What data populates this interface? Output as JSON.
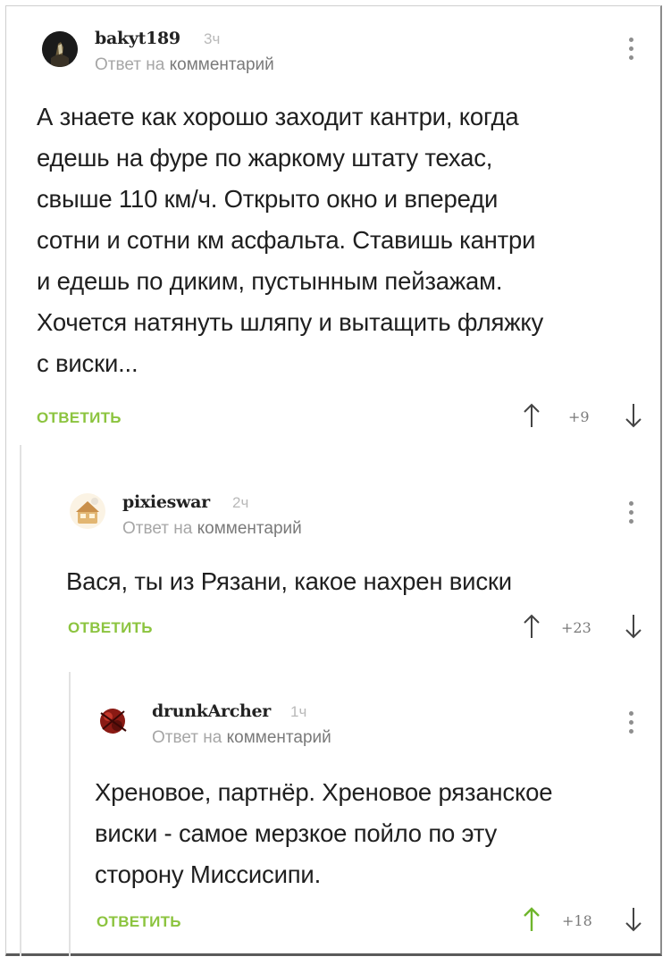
{
  "comments": [
    {
      "username": "bakyt189",
      "time": "3ч",
      "reply_prefix": "Ответ на",
      "reply_link": "комментарий",
      "body": [
        "А знаете как хорошо заходит кантри, когда",
        "едешь на фуре по жаркому штату техас,",
        "свыше 110 км/ч. Открыто окно и впереди",
        "сотни и сотни км асфальта. Ставишь кантри",
        "и едешь по диким, пустынным пейзажам.",
        "Хочется натянуть шляпу и вытащить фляжку",
        "с виски..."
      ],
      "reply_label": "ОТВЕТИТЬ",
      "score": "+9"
    },
    {
      "username": "pixieswar",
      "time": "2ч",
      "reply_prefix": "Ответ на",
      "reply_link": "комментарий",
      "body": [
        "Вася, ты из Рязани, какое нахрен виски"
      ],
      "reply_label": "ОТВЕТИТЬ",
      "score": "+23"
    },
    {
      "username": "drunkArcher",
      "time": "1ч",
      "reply_prefix": "Ответ на",
      "reply_link": "комментарий",
      "body": [
        "Хреновое, партнёр. Хреновое рязанское",
        "виски - самое мерзкое пойло по эту",
        "сторону Миссисипи."
      ],
      "reply_label": "ОТВЕТИТЬ",
      "score": "+18"
    }
  ],
  "colors": {
    "accent": "#8cc43f",
    "text": "#1f1f1f",
    "muted": "#a6a6a6"
  },
  "icons": [
    "more-vertical-icon",
    "arrow-up-icon",
    "arrow-down-icon",
    "avatar"
  ]
}
